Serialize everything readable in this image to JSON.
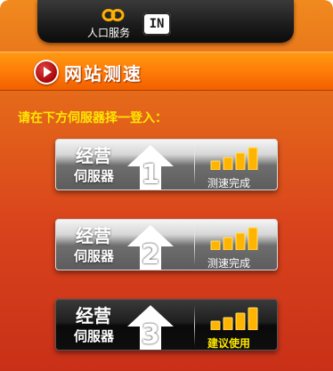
{
  "header": {
    "entry_label": "人口服务",
    "badge": "IN",
    "icon": "loop-icon"
  },
  "title_bar": {
    "title": "网站测速",
    "icon": "play-icon"
  },
  "instruction": "请在下方伺服器择一登入：",
  "servers": [
    {
      "line1": "经营",
      "line2": "伺服器",
      "number": "1",
      "status": "测速完成",
      "style": "light",
      "status_color": "#ffffff",
      "signal_bars": 4
    },
    {
      "line1": "经营",
      "line2": "伺服器",
      "number": "2",
      "status": "测速完成",
      "style": "light",
      "status_color": "#ffffff",
      "signal_bars": 4
    },
    {
      "line1": "经营",
      "line2": "伺服器",
      "number": "3",
      "status": "建议使用",
      "style": "dark",
      "status_color": "#ffe800",
      "signal_bars": 4
    }
  ],
  "colors": {
    "background_top": "#f08a1e",
    "background_bottom": "#c93018",
    "title_bar": "#ff7c08",
    "instruction": "#ffe800",
    "signal": "#ffb400"
  }
}
